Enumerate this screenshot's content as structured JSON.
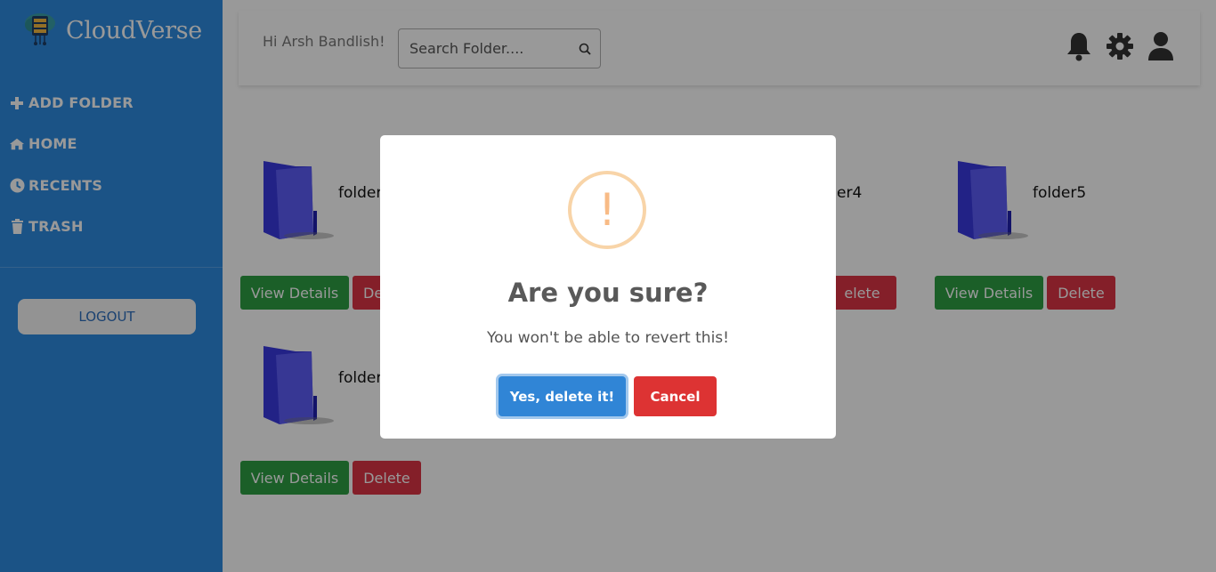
{
  "sidebar": {
    "brand": "CloudVerse",
    "items": [
      {
        "label": "ADD FOLDER",
        "icon": "plus-icon"
      },
      {
        "label": "HOME",
        "icon": "home-icon"
      },
      {
        "label": "RECENTS",
        "icon": "clock-icon"
      },
      {
        "label": "TRASH",
        "icon": "trash-icon"
      }
    ],
    "logout_label": "LOGOUT"
  },
  "header": {
    "greeting": "Hi Arsh Bandlish!",
    "search_placeholder": "Search Folder....",
    "icons": [
      "bell-icon",
      "gear-icon",
      "user-icon"
    ]
  },
  "folders": [
    {
      "name": "folder",
      "view_label": "View Details",
      "delete_label": "De"
    },
    {
      "name": "er4",
      "view_label": "",
      "delete_label": "elete"
    },
    {
      "name": "folder5",
      "view_label": "View Details",
      "delete_label": "Delete"
    },
    {
      "name": "folder",
      "view_label": "View Details",
      "delete_label": "Delete"
    }
  ],
  "modal": {
    "icon": "!",
    "title": "Are you sure?",
    "text": "You won't be able to revert this!",
    "confirm_label": "Yes, delete it!",
    "cancel_label": "Cancel"
  },
  "colors": {
    "sidebar": "#2d8ae0",
    "view_button": "#2e9e44",
    "delete_button": "#dc3545",
    "confirm": "#3085d6",
    "cancel": "#dd3333",
    "warning": "#f8bb86"
  }
}
